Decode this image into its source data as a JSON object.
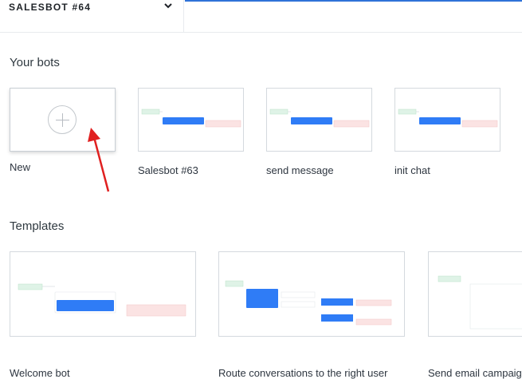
{
  "header": {
    "bot_name": "SALESBOT #64"
  },
  "sections": {
    "your_bots": "Your bots",
    "templates": "Templates"
  },
  "bots": [
    {
      "label": "New"
    },
    {
      "label": "Salesbot #63"
    },
    {
      "label": "send message"
    },
    {
      "label": "init chat"
    }
  ],
  "templates": [
    {
      "label": "Welcome bot"
    },
    {
      "label": "Route conversations to the right user"
    },
    {
      "label": "Send email campaign"
    }
  ],
  "colors": {
    "accent": "#2f72d8",
    "arrow": "#e02020",
    "start_node": "#dff3e7",
    "action_node": "#2f7cf6",
    "end_node": "#fbe3e3"
  }
}
